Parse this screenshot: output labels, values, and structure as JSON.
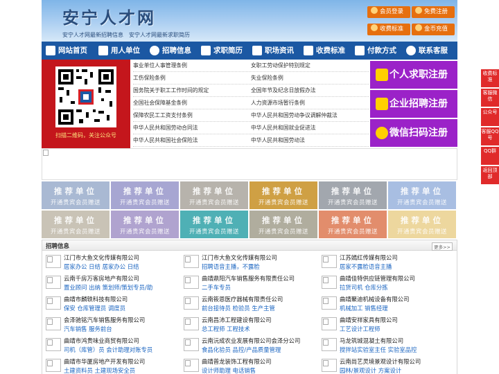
{
  "header": {
    "title": "安宁人才网",
    "sub1": "安宁人才网最新招聘信息",
    "sub2": "安宁人才网最新求职简历",
    "buttons": [
      "会员登录",
      "免费注册",
      "收费标准",
      "金币充值"
    ]
  },
  "nav": [
    "网站首页",
    "用人单位",
    "招聘信息",
    "求职简历",
    "职场资讯",
    "收费标准",
    "付款方式",
    "联系客服"
  ],
  "qr": {
    "caption": "扫描二维码，关注公众号"
  },
  "laws": [
    [
      "事业单位人事管理条例",
      "女职工劳动保护特别规定"
    ],
    [
      "工伤保险条例",
      "失业保险条例"
    ],
    [
      "国务院关于职工工作时间的规定",
      "全国年节及纪念日放假办法"
    ],
    [
      "全国社会保障基金条例",
      "人力资源市场暂行条例"
    ],
    [
      "保障农民工工资支付条例",
      "中华人民共和国劳动争议调解仲裁法"
    ],
    [
      "中华人民共和国劳动合同法",
      "中华人民共和国就业促进法"
    ],
    [
      "中华人民共和国社会保险法",
      "中华人民共和国劳动法"
    ]
  ],
  "register": [
    "个人求职注册",
    "企业招聘注册",
    "微信扫码注册"
  ],
  "ads": {
    "line1": "推荐单位",
    "line2": "开通贵宾会员赠送",
    "colors": [
      "#a9b9d3",
      "#a7a6d2",
      "#b7b3ac",
      "#cfa044",
      "#a2a7ae",
      "#a8bee2",
      "#c9c3b6",
      "#b0a3cf",
      "#4fb0b5",
      "#b0ad9e",
      "#e28d6c",
      "#edd79e"
    ]
  },
  "jobs_section": {
    "title": "招聘信息",
    "more": "更多>>"
  },
  "jobs": [
    {
      "company": "江门市大鱼文化传媒有限公司",
      "positions": "居家办公 日结 居家办公 日结"
    },
    {
      "company": "江门市大鱼文化传媒有限公司",
      "positions": "招聘语音主播，不露脸"
    },
    {
      "company": "江苏嫣红传媒有限公司",
      "positions": "居家不露脸语音主播"
    },
    {
      "company": "云南千房万客房地产有限公司",
      "positions": "置业顾问 出纳 策划师/策划专员/助"
    },
    {
      "company": "曲靖鼎阳汽车销售服务有限责任公司",
      "positions": "二手车专员"
    },
    {
      "company": "曲靖佳特供应链管理有限公司",
      "positions": "拉货司机 仓库分拣"
    },
    {
      "company": "曲靖市麟轶科技有限公司",
      "positions": "保安 仓库管理员 调度员"
    },
    {
      "company": "云南筱恩医疗器械有限责任公司",
      "positions": "前台接待员 检验员 生产主管"
    },
    {
      "company": "曲靖聚迪机械设备有限公司",
      "positions": "机械加工 销售经理"
    },
    {
      "company": "会泽驰铭汽车销售服务有限公司",
      "positions": "汽车销售 服务前台"
    },
    {
      "company": "云南昌沛工程建设有限公司",
      "positions": "总工程师 工程技术"
    },
    {
      "company": "曲靖安祥家具有限公司",
      "positions": "工艺设计工程师"
    },
    {
      "company": "曲靖市鸿贵味业商贸有限公司",
      "positions": "司机（库管）员 会计助理对账专员"
    },
    {
      "company": "云南沅成农业发展有限公司会泽分公司",
      "positions": "食品化验员 品控/产品质量管理"
    },
    {
      "company": "马龙筑城混凝土有限公司",
      "positions": "搅拌站实验室主任 实验室品控"
    },
    {
      "company": "曲靖市华厦房地产开发有限公司",
      "positions": "土建资料员 土建现场安全员"
    },
    {
      "company": "曲靖普龙装饰工程有限公司",
      "positions": "设计师助理 电话销售"
    },
    {
      "company": "云南尚艺灵境景观设计有限公司",
      "positions": "园林/景观设计 方案设计"
    }
  ],
  "sidebar": [
    "收费标准",
    "客服微信",
    "公众号",
    "客服QQ号",
    "QQ群",
    "返回顶部"
  ]
}
